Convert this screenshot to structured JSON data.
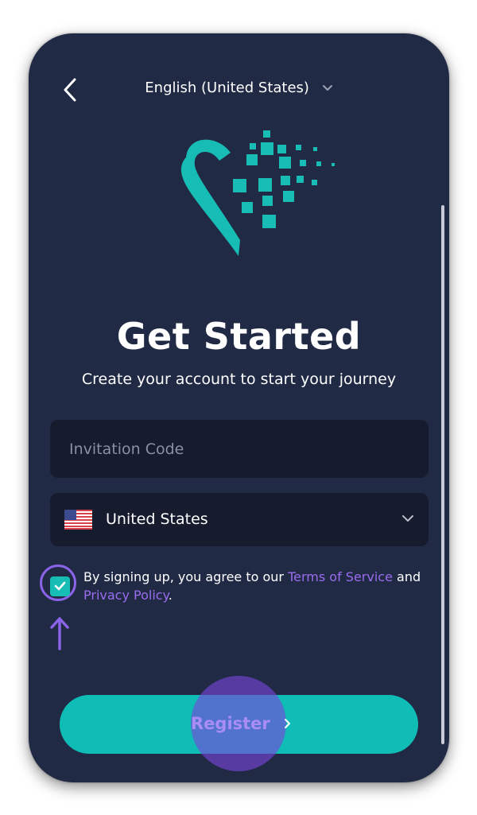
{
  "header": {
    "back_icon": "chevron-left-icon",
    "language": "English (United States)",
    "language_icon": "chevron-down-icon"
  },
  "logo": {
    "icon": "pixel-heart-logo-icon",
    "color": "#17bdb5"
  },
  "hero": {
    "title": "Get Started",
    "subtitle": "Create your account to start your journey"
  },
  "form": {
    "invitation_code": {
      "value": "",
      "placeholder": "Invitation Code"
    },
    "country": {
      "flag_icon": "us-flag-icon",
      "selected": "United States",
      "dropdown_icon": "chevron-down-icon"
    },
    "agreement": {
      "checked": true,
      "text_before": "By signing up, you agree to our ",
      "terms_link": "Terms of Service",
      "text_middle": " and ",
      "privacy_link": "Privacy Policy",
      "text_after": "."
    }
  },
  "actions": {
    "register_label": "Register",
    "register_icon": "chevron-right-icon"
  },
  "colors": {
    "background": "#212a45",
    "field": "#161b2e",
    "accent": "#17bdb5",
    "link": "#9a6cf0",
    "highlight": "#8a63e8"
  }
}
